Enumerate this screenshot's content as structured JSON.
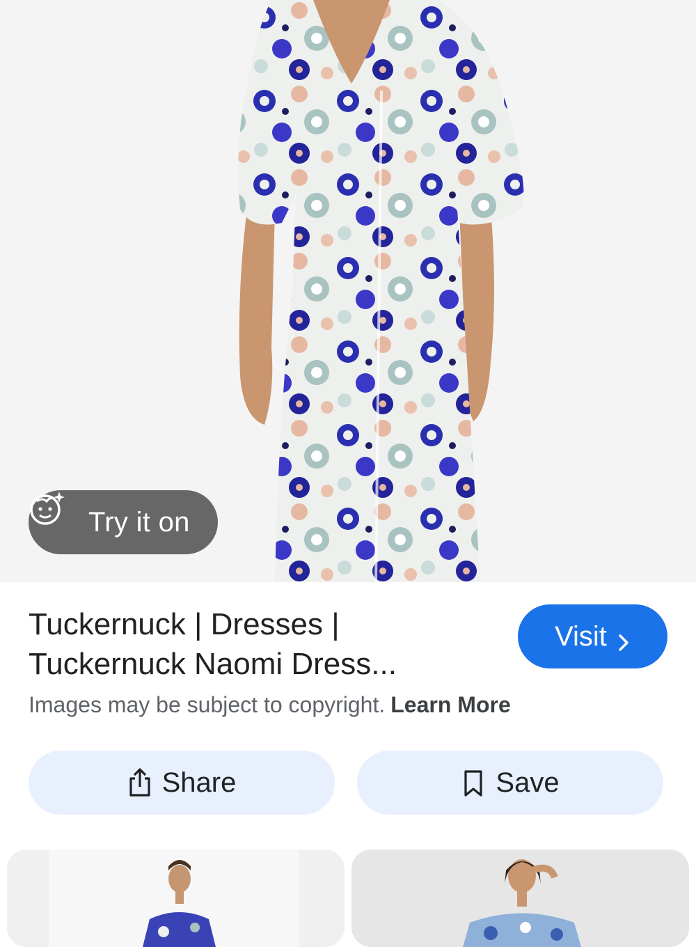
{
  "hero": {
    "image": "floral-maxi-dress-photo",
    "try_on_label": "Try it on",
    "try_on_icon": "face-sparkle-icon"
  },
  "result": {
    "title_line1": "Tuckernuck | Dresses |",
    "title_line2": "Tuckernuck Naomi Dress...",
    "visit_label": "Visit",
    "visit_icon": "chevron-right-icon",
    "copyright_text": "Images may be subject to copyright.",
    "learn_more": "Learn More"
  },
  "actions": {
    "share_label": "Share",
    "share_icon": "share-icon",
    "save_label": "Save",
    "save_icon": "bookmark-icon"
  },
  "related": {
    "items": [
      "related-dress-thumbnail-1",
      "related-dress-thumbnail-2"
    ]
  },
  "colors": {
    "accent": "#1a73e8",
    "chip_bg": "#e8f0fe",
    "overlay_chip": "#5a5a5a"
  }
}
